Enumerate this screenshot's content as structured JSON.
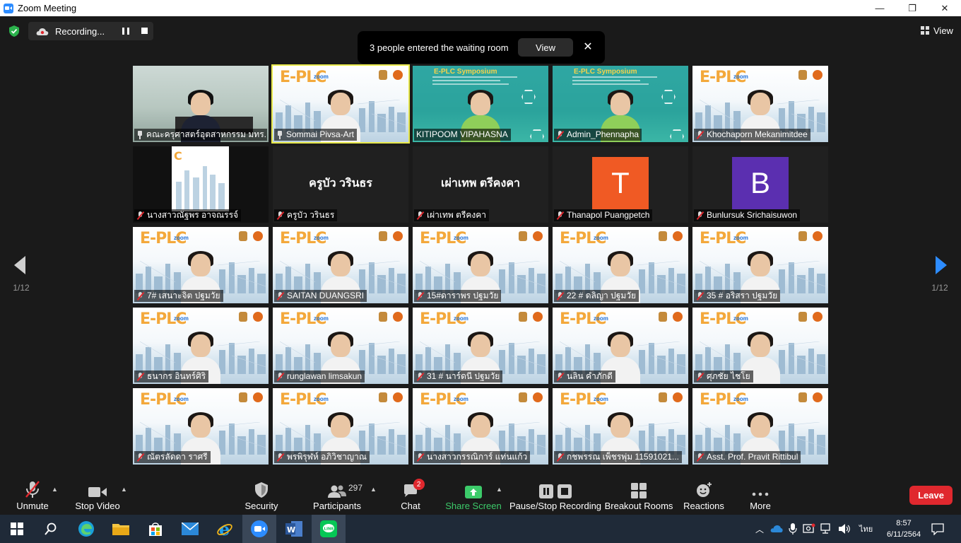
{
  "window": {
    "title": "Zoom Meeting",
    "minimize": "—",
    "maximize": "❐",
    "close": "✕"
  },
  "recording": {
    "label": "Recording..."
  },
  "view_button": {
    "label": "View"
  },
  "waiting_banner": {
    "text": "3 people entered the waiting room",
    "view_label": "View",
    "close": "✕"
  },
  "pager": {
    "left_page": "1/12",
    "right_page": "1/12"
  },
  "tiles": [
    {
      "name": "คณะครุศาสตร์อุตสาหกรรม มทร...",
      "kind": "room",
      "icon": "pin",
      "active": false
    },
    {
      "name": "Sommai Pivsa-Art",
      "kind": "template",
      "icon": "pin",
      "active": true
    },
    {
      "name": "KITIPOOM VIPAHASNA",
      "kind": "symp",
      "icon": "none",
      "active": false
    },
    {
      "name": "Admin_Phennapha",
      "kind": "symp",
      "icon": "mute",
      "active": false
    },
    {
      "name": "Khochaporn Mekanimitdee",
      "kind": "template",
      "icon": "mute",
      "active": false
    },
    {
      "name": "นางสาวณัฐพร อาจณรรจ์",
      "kind": "slide",
      "icon": "mute",
      "active": false
    },
    {
      "name": "ครูบัว วรินธร",
      "kind": "blank",
      "big": "ครูบัว วรินธร",
      "icon": "mute",
      "active": false
    },
    {
      "name": "เผ่าเทพ  ตรีคงคา",
      "kind": "blank",
      "big": "เผ่าเทพ  ตรีคงคา",
      "icon": "mute",
      "active": false
    },
    {
      "name": "Thanapol Puangpetch",
      "kind": "avatar",
      "letter": "T",
      "color": "#f05a24",
      "icon": "mute",
      "active": false
    },
    {
      "name": "Bunlursuk Srichaisuwon",
      "kind": "avatar",
      "letter": "B",
      "color": "#5b2fb0",
      "icon": "mute",
      "active": false
    },
    {
      "name": "7# เสนาะจิต ปฐมวัย",
      "kind": "template",
      "icon": "mute",
      "active": false
    },
    {
      "name": "SAITAN DUANGSRI",
      "kind": "template",
      "icon": "mute",
      "active": false
    },
    {
      "name": "15#ดาราพร ปฐมวัย",
      "kind": "template",
      "icon": "mute",
      "active": false
    },
    {
      "name": "22 # ดลิญา  ปฐมวัย",
      "kind": "template",
      "icon": "mute",
      "active": false
    },
    {
      "name": "35 # อริสรา ปฐมวัย",
      "kind": "template",
      "icon": "mute",
      "active": false
    },
    {
      "name": "ธนากร อินทร์ศิริ",
      "kind": "template",
      "icon": "mute",
      "active": false
    },
    {
      "name": "runglawan limsakun",
      "kind": "template",
      "icon": "mute",
      "active": false
    },
    {
      "name": "31 # นาร์ดนี ปฐมวัย",
      "kind": "template",
      "icon": "mute",
      "active": false
    },
    {
      "name": "นลิน คำภักดี",
      "kind": "template",
      "icon": "mute",
      "active": false
    },
    {
      "name": "ศุภชัย ไชโย",
      "kind": "template",
      "icon": "mute",
      "active": false
    },
    {
      "name": "ณัตรลัดดา ราศรี",
      "kind": "template",
      "icon": "mute",
      "active": false
    },
    {
      "name": "พรพิรุฬห์  อภิวิชาญาณ",
      "kind": "template",
      "icon": "mute",
      "active": false
    },
    {
      "name": "นางสาวกรรณิการ์  แท่นแก้ว",
      "kind": "template",
      "icon": "mute",
      "active": false
    },
    {
      "name": "กชพรรณ เพ็ชรพุ่ม 11591021...",
      "kind": "template",
      "icon": "mute",
      "active": false
    },
    {
      "name": "Asst. Prof. Pravit Rittibul",
      "kind": "template",
      "icon": "mute",
      "active": false
    }
  ],
  "toolbar": {
    "unmute": "Unmute",
    "stop_video": "Stop Video",
    "security": "Security",
    "participants": "Participants",
    "participants_count": "297",
    "chat": "Chat",
    "chat_badge": "2",
    "share_screen": "Share Screen",
    "pause_stop_recording": "Pause/Stop Recording",
    "breakout_rooms": "Breakout Rooms",
    "reactions": "Reactions",
    "more": "More",
    "leave": "Leave"
  },
  "taskbar": {
    "apps": [
      "start",
      "search",
      "edge",
      "file-explorer",
      "store",
      "mail",
      "internet-explorer",
      "zoom",
      "word",
      "line"
    ],
    "language": "ไทย",
    "time": "8:57",
    "date": "6/11/2564"
  },
  "colors": {
    "accent_green": "#3ccb6a",
    "leave_red": "#e0282e",
    "active_speaker": "#e8e84a"
  }
}
